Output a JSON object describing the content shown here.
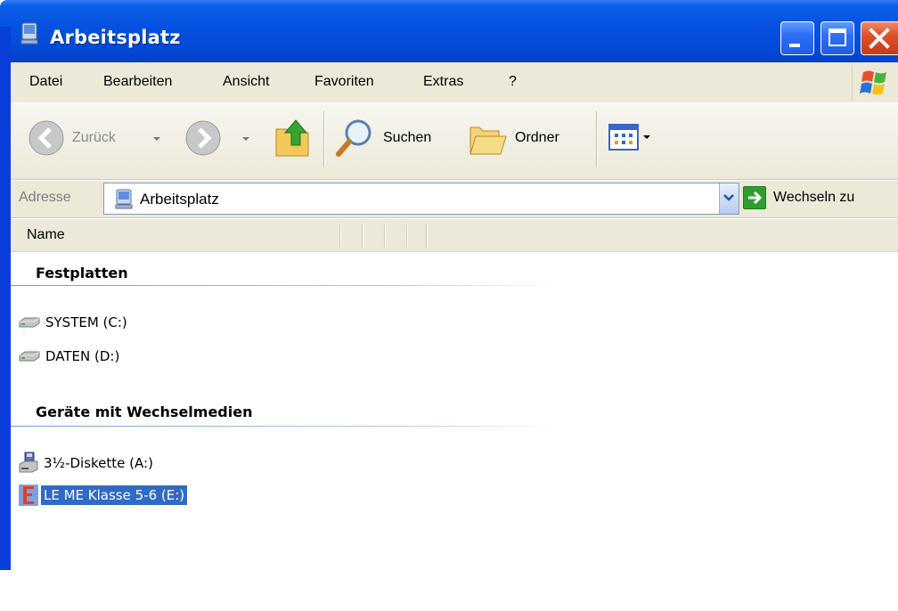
{
  "window": {
    "title": "Arbeitsplatz"
  },
  "menu": {
    "items": [
      "Datei",
      "Bearbeiten",
      "Ansicht",
      "Favoriten",
      "Extras",
      "?"
    ]
  },
  "toolbar": {
    "back_label": "Zurück",
    "search_label": "Suchen",
    "folders_label": "Ordner"
  },
  "address": {
    "label": "Adresse",
    "value": "Arbeitsplatz",
    "go_label": "Wechseln zu"
  },
  "columns": {
    "name": "Name"
  },
  "groups": [
    {
      "title": "Festplatten",
      "items": [
        {
          "label": "SYSTEM (C:)",
          "icon": "hard-drive-icon"
        },
        {
          "label": "DATEN (D:)",
          "icon": "hard-drive-icon"
        }
      ]
    },
    {
      "title": "Geräte mit Wechselmedien",
      "items": [
        {
          "label": "3½-Diskette (A:)",
          "icon": "floppy-drive-icon"
        },
        {
          "label": "LE ME Klasse 5-6 (E:)",
          "icon": "removable-drive-icon",
          "selected": true
        }
      ]
    }
  ],
  "colors": {
    "titlebar": "#0553e0",
    "selection": "#316ac5",
    "chrome": "#ece9d8"
  }
}
